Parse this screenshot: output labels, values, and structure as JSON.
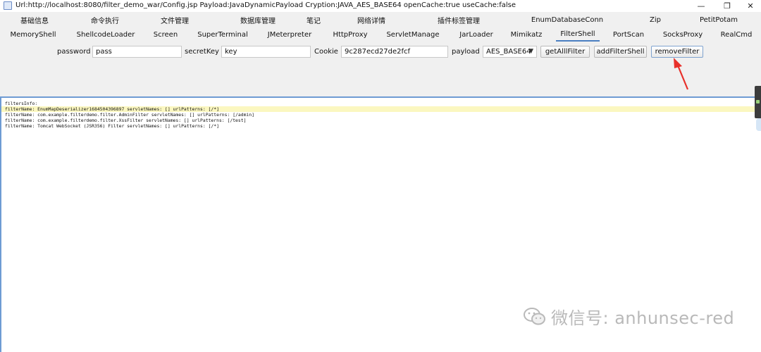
{
  "window": {
    "title": "Url:http://localhost:8080/filter_demo_war/Config.jsp Payload:JavaDynamicPayload Cryption:JAVA_AES_BASE64 openCache:true useCache:false",
    "minimize_glyph": "—",
    "maximize_glyph": "❐",
    "close_glyph": "✕"
  },
  "tabs_row1": [
    "基础信息",
    "命令执行",
    "文件管理",
    "数据库管理",
    "笔记",
    "网络详情",
    "插件标签管理",
    "EnumDatabaseConn",
    "Zip",
    "PetitPotam"
  ],
  "tabs_row2": [
    "MemoryShell",
    "ShellcodeLoader",
    "Screen",
    "SuperTerminal",
    "JMeterpreter",
    "HttpProxy",
    "ServletManage",
    "JarLoader",
    "Mimikatz",
    "FilterShell",
    "PortScan",
    "SocksProxy",
    "RealCmd"
  ],
  "active_tab": "FilterShell",
  "form": {
    "password_label": "password :",
    "password_value": "pass",
    "secretkey_label": "secretKey :",
    "secretkey_value": "key",
    "cookie_label": "Cookie :",
    "cookie_value": "9c287ecd27de2fcf",
    "payload_label": "payload :",
    "payload_value": "AES_BASE64",
    "get_all_filter_label": "getAlllFilter",
    "add_filter_shell_label": "addFilterShell",
    "remove_filter_label": "removeFilter"
  },
  "output": {
    "lines": [
      "filtersInfo:",
      "filterName: EnumMapDeserializer1684504396897 servletNames: [] urlPatterns: [/*]",
      "filterName: com.example.filterdemo.filter.AdminFilter servletNames: [] urlPatterns: [/admin]",
      "filterName: com.example.filterdemo.filter.XssFilter servletNames: [] urlPatterns: [/test]",
      "filterName: Tomcat WebSocket (JSR356) Filter servletNames: [] urlPatterns: [/*]"
    ]
  },
  "watermark": {
    "text": "微信号: anhunsec-red",
    "icon": "wechat-icon"
  },
  "colors": {
    "accent": "#4a7fc1",
    "arrow": "#e8302a",
    "highlight": "#fbf7c0"
  }
}
